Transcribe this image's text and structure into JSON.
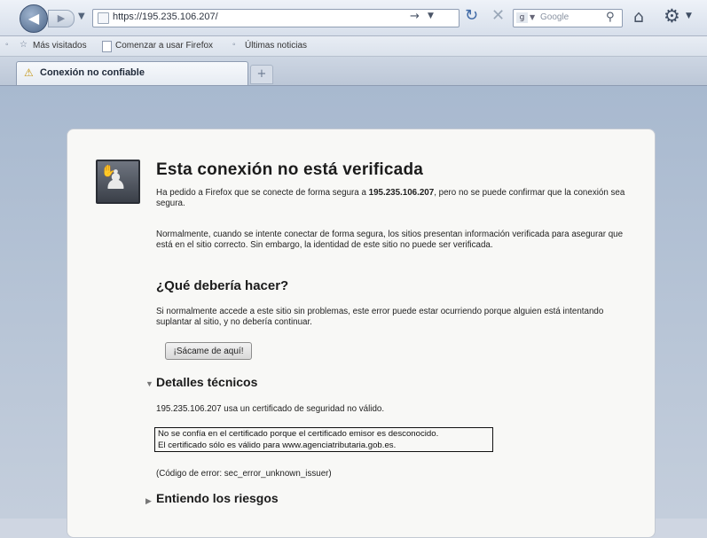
{
  "browser": {
    "url": "https://195.235.106.207/",
    "search_placeholder": "Google"
  },
  "bookmarks": [
    {
      "label": "Más visitados"
    },
    {
      "label": "Comenzar a usar Firefox"
    },
    {
      "label": "Últimas noticias"
    }
  ],
  "tab": {
    "label": "Conexión no confiable"
  },
  "error": {
    "title": "Esta conexión no está verificada",
    "intro_before": "Ha pedido a Firefox que se conecte de forma segura a ",
    "intro_host": "195.235.106.207",
    "intro_after": ", pero no se puede confirmar que la conexión sea segura.",
    "explanation": "Normalmente, cuando se intente conectar de forma segura, los sitios presentan información verificada para asegurar que está en el sitio correcto. Sin embargo, la identidad de este sitio no puede ser verificada.",
    "what_heading": "¿Qué debería hacer?",
    "what_text": "Si normalmente accede a este sitio sin problemas, este error puede estar ocurriendo porque alguien está intentando suplantar al sitio, y no debería continuar.",
    "get_out_label": "¡Sácame de aquí!",
    "tech_heading": "Detalles técnicos",
    "tech_line": "195.235.106.207 usa un certificado de seguridad no válido.",
    "cert_line1": "No se confía en el certificado porque el certificado emisor es desconocido.",
    "cert_line2": "El certificado sólo es válido para www.agenciatributaria.gob.es.",
    "error_code": "(Código de error: sec_error_unknown_issuer)",
    "risks_heading": "Entiendo los riesgos"
  }
}
